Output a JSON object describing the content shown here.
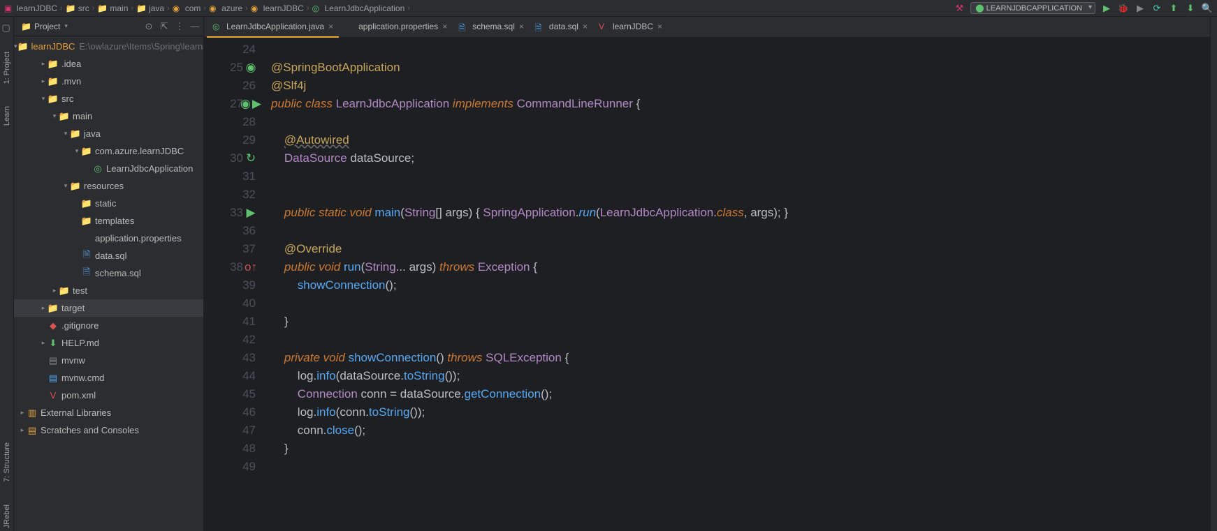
{
  "breadcrumb": [
    {
      "icon": "project",
      "label": "learnJDBC"
    },
    {
      "icon": "folder-src",
      "label": "src"
    },
    {
      "icon": "folder",
      "label": "main"
    },
    {
      "icon": "folder-src",
      "label": "java"
    },
    {
      "icon": "package",
      "label": "com"
    },
    {
      "icon": "package",
      "label": "azure"
    },
    {
      "icon": "package",
      "label": "learnJDBC"
    },
    {
      "icon": "class",
      "label": "LearnJdbcApplication"
    }
  ],
  "run_config": "LEARNJDBCAPPLICATION",
  "sidebar_title": "Project",
  "project": {
    "name": "learnJDBC",
    "path": "E:\\owlazure\\Items\\Spring\\learnJD"
  },
  "tree": [
    {
      "depth": 1,
      "arrow": "right",
      "iconcls": "fold-gray",
      "icon": "📁",
      "label": ".idea"
    },
    {
      "depth": 1,
      "arrow": "right",
      "iconcls": "fold-gray",
      "icon": "📁",
      "label": ".mvn"
    },
    {
      "depth": 1,
      "arrow": "down",
      "iconcls": "fold-cyan",
      "icon": "📁",
      "label": "src"
    },
    {
      "depth": 2,
      "arrow": "down",
      "iconcls": "fold-cyan",
      "icon": "📁",
      "label": "main"
    },
    {
      "depth": 3,
      "arrow": "down",
      "iconcls": "fold-cyan",
      "icon": "📁",
      "label": "java"
    },
    {
      "depth": 4,
      "arrow": "down",
      "iconcls": "fold-cyan",
      "icon": "📁",
      "label": "com.azure.learnJDBC"
    },
    {
      "depth": 5,
      "arrow": "blank",
      "iconcls": "file-green",
      "icon": "◎",
      "label": "LearnJdbcApplication"
    },
    {
      "depth": 3,
      "arrow": "down",
      "iconcls": "fold-orange",
      "icon": "📁",
      "label": "resources"
    },
    {
      "depth": 4,
      "arrow": "blank",
      "iconcls": "file-blue",
      "icon": "📁",
      "label": "static"
    },
    {
      "depth": 4,
      "arrow": "blank",
      "iconcls": "fold-orange",
      "icon": "📁",
      "label": "templates"
    },
    {
      "depth": 4,
      "arrow": "blank",
      "iconcls": "file-blue",
      "icon": "</>",
      "label": "application.properties"
    },
    {
      "depth": 4,
      "arrow": "blank",
      "iconcls": "file-blue",
      "icon": "🗎",
      "label": "data.sql"
    },
    {
      "depth": 4,
      "arrow": "blank",
      "iconcls": "file-blue",
      "icon": "🗎",
      "label": "schema.sql"
    },
    {
      "depth": 2,
      "arrow": "right",
      "iconcls": "file-green",
      "icon": "📁",
      "label": "test"
    },
    {
      "depth": 1,
      "arrow": "right",
      "iconcls": "file-red",
      "icon": "📁",
      "label": "target",
      "selected": true
    },
    {
      "depth": 1,
      "arrow": "blank",
      "iconcls": "file-red",
      "icon": "◆",
      "label": ".gitignore"
    },
    {
      "depth": 1,
      "arrow": "right",
      "iconcls": "file-green",
      "icon": "⬇",
      "label": "HELP.md"
    },
    {
      "depth": 1,
      "arrow": "blank",
      "iconcls": "file-gray",
      "icon": "▤",
      "label": "mvnw"
    },
    {
      "depth": 1,
      "arrow": "blank",
      "iconcls": "file-blue",
      "icon": "▤",
      "label": "mvnw.cmd"
    },
    {
      "depth": 1,
      "arrow": "blank",
      "iconcls": "file-red",
      "icon": "V",
      "label": "pom.xml"
    }
  ],
  "tree_extra": [
    {
      "label": "External Libraries",
      "icon": "▥"
    },
    {
      "label": "Scratches and Consoles",
      "icon": "▤"
    }
  ],
  "tabs": [
    {
      "icon": "class",
      "label": "LearnJdbcApplication.java",
      "active": true
    },
    {
      "icon": "props",
      "label": "application.properties"
    },
    {
      "icon": "sql",
      "label": "schema.sql"
    },
    {
      "icon": "sql",
      "label": "data.sql"
    },
    {
      "icon": "maven",
      "label": "learnJDBC"
    }
  ],
  "leftstrip": {
    "tab_project": "1: Project",
    "tab_learn": "Learn",
    "tab_structure": "7: Structure",
    "tab_jrebel": "JRebel"
  },
  "code_lines": [
    {
      "n": 24,
      "html": ""
    },
    {
      "n": 25,
      "html": "<span class='tok-ann'>@SpringBootApplication</span>",
      "gicon": "spring"
    },
    {
      "n": 26,
      "html": "<span class='tok-ann'>@Slf4j</span>"
    },
    {
      "n": 27,
      "html": "<span class='tok-key'>public</span> <span class='tok-key'>class</span> <span class='tok-type'>LearnJdbcApplication</span> <span class='tok-key'>implements</span> <span class='tok-type'>CommandLineRunner</span> {",
      "gicon": "run-class"
    },
    {
      "n": 28,
      "html": ""
    },
    {
      "n": 29,
      "html": "    <span class='tok-ann-u'>@Autowired</span>"
    },
    {
      "n": 30,
      "html": "    <span class='tok-type'>DataSource</span> <span class='tok-var'>dataSource</span>;",
      "gicon": "bean"
    },
    {
      "n": 31,
      "html": ""
    },
    {
      "n": 32,
      "html": ""
    },
    {
      "n": 33,
      "html": "    <span class='tok-key'>public</span> <span class='tok-key'>static</span> <span class='tok-key'>void</span> <span class='tok-method'>main</span>(<span class='tok-type'>String</span>[] <span class='tok-var'>args</span>) { <span class='tok-type'>SpringApplication</span>.<span class='tok-method-i'>run</span>(<span class='tok-type'>LearnJdbcApplication</span>.<span class='tok-key'>class</span>, <span class='tok-var'>args</span>); }",
      "gicon": "run-main"
    },
    {
      "n": 36,
      "html": ""
    },
    {
      "n": 37,
      "html": "    <span class='tok-ann'>@Override</span>"
    },
    {
      "n": 38,
      "html": "    <span class='tok-key'>public</span> <span class='tok-key'>void</span> <span class='tok-method'>run</span>(<span class='tok-type'>String</span>... <span class='tok-var'>args</span>) <span class='tok-key'>throws</span> <span class='tok-type'>Exception</span> {",
      "gicon": "override"
    },
    {
      "n": 39,
      "html": "        <span class='tok-method'>showConnection</span>();"
    },
    {
      "n": 40,
      "html": ""
    },
    {
      "n": 41,
      "html": "    }"
    },
    {
      "n": 42,
      "html": ""
    },
    {
      "n": 43,
      "html": "    <span class='tok-key'>private</span> <span class='tok-key'>void</span> <span class='tok-method'>showConnection</span>() <span class='tok-key'>throws</span> <span class='tok-type'>SQLException</span> {"
    },
    {
      "n": 44,
      "html": "        <span class='tok-var'>log</span>.<span class='tok-method'>info</span>(<span class='tok-var'>dataSource</span>.<span class='tok-method'>toString</span>());"
    },
    {
      "n": 45,
      "html": "        <span class='tok-type'>Connection</span> <span class='tok-var'>conn</span> = <span class='tok-var'>dataSource</span>.<span class='tok-method'>getConnection</span>();"
    },
    {
      "n": 46,
      "html": "        <span class='tok-var'>log</span>.<span class='tok-method'>info</span>(<span class='tok-var'>conn</span>.<span class='tok-method'>toString</span>());"
    },
    {
      "n": 47,
      "html": "        <span class='tok-var'>conn</span>.<span class='tok-method'>close</span>();"
    },
    {
      "n": 48,
      "html": "    }"
    },
    {
      "n": 49,
      "html": ""
    }
  ]
}
